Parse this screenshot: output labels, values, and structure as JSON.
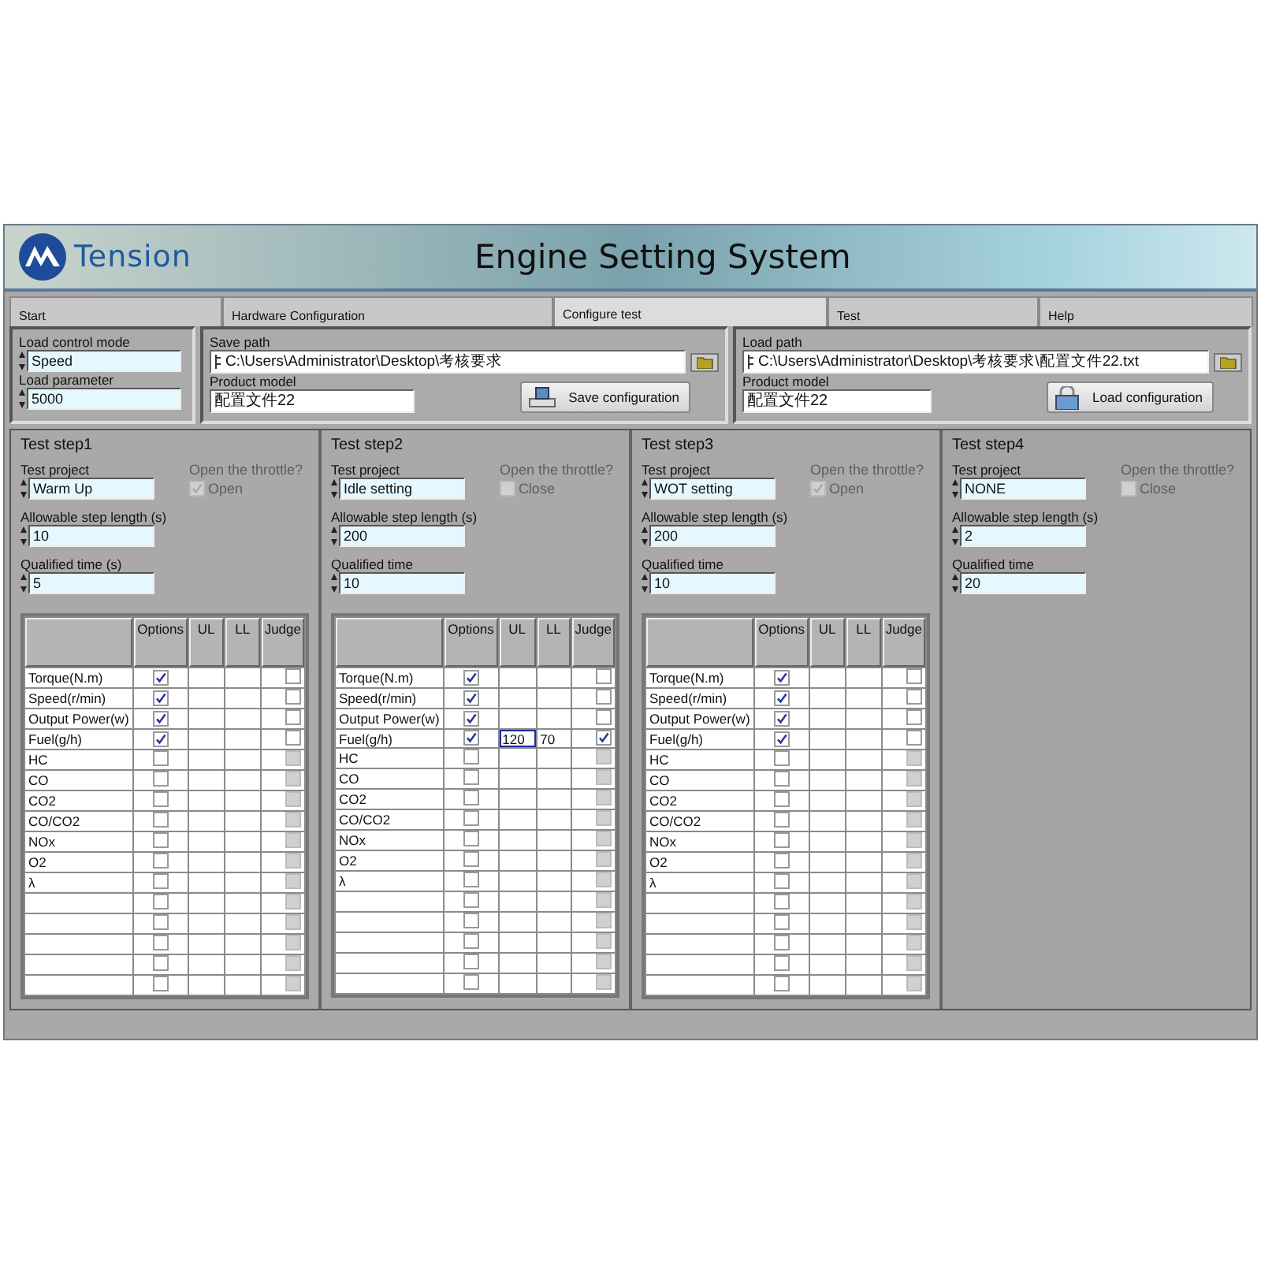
{
  "window": {
    "title": "Engine Setting System",
    "logo": "Tension"
  },
  "tabs": [
    {
      "label": "Start",
      "selected": false
    },
    {
      "label": "Hardware Configuration",
      "selected": false
    },
    {
      "label": "Configure test",
      "selected": true
    },
    {
      "label": "Test",
      "selected": false
    },
    {
      "label": "Help",
      "selected": false
    }
  ],
  "load_control": {
    "mode_label": "Load control mode",
    "mode": "Speed",
    "param_label": "Load parameter",
    "param": "5000"
  },
  "save": {
    "path_label": "Save path",
    "path": "C:\\Users\\Administrator\\Desktop\\考核要求",
    "model_label": "Product model",
    "model": "配置文件22",
    "button": "Save configuration"
  },
  "load": {
    "path_label": "Load path",
    "path": "C:\\Users\\Administrator\\Desktop\\考核要求\\配置文件22.txt",
    "model_label": "Product model",
    "model": "配置文件22",
    "button": "Load configuration"
  },
  "steps": [
    {
      "title": "Test step1",
      "project_label": "Test project",
      "project": "Warm Up",
      "throttle_label": "Open the throttle?",
      "throttle": {
        "label": "Open",
        "checked": true
      },
      "length_label": "Allowable step length (s)",
      "length": "10",
      "time_label": "Qualified time (s)",
      "time": "5",
      "table": {
        "columns": [
          "Options",
          "UL",
          "LL",
          "Judge"
        ],
        "rows": [
          {
            "name": "Torque(N.m)",
            "option": true,
            "judge": false,
            "judge_disabled": false
          },
          {
            "name": "Speed(r/min)",
            "option": true,
            "judge": false,
            "judge_disabled": false
          },
          {
            "name": "Output Power(w)",
            "option": true,
            "judge": false,
            "judge_disabled": false
          },
          {
            "name": "Fuel(g/h)",
            "option": true,
            "judge": false,
            "judge_disabled": false
          },
          {
            "name": "HC",
            "option": false,
            "judge": false,
            "judge_disabled": true
          },
          {
            "name": "CO",
            "option": false,
            "judge": false,
            "judge_disabled": true
          },
          {
            "name": "CO2",
            "option": false,
            "judge": false,
            "judge_disabled": true
          },
          {
            "name": "CO/CO2",
            "option": false,
            "judge": false,
            "judge_disabled": true
          },
          {
            "name": "NOx",
            "option": false,
            "judge": false,
            "judge_disabled": true
          },
          {
            "name": "O2",
            "option": false,
            "judge": false,
            "judge_disabled": true
          },
          {
            "name": "λ",
            "option": false,
            "judge": false,
            "judge_disabled": true
          },
          {
            "option": false,
            "judge": false,
            "judge_disabled": true
          },
          {
            "option": false,
            "judge": false,
            "judge_disabled": true
          },
          {
            "option": false,
            "judge": false,
            "judge_disabled": true
          },
          {
            "option": false,
            "judge": false,
            "judge_disabled": true
          },
          {
            "option": false,
            "judge": false,
            "judge_disabled": true
          }
        ]
      }
    },
    {
      "title": "Test step2",
      "project_label": "Test project",
      "project": "Idle setting",
      "throttle_label": "Open the throttle?",
      "throttle": {
        "label": "Close",
        "checked": false
      },
      "length_label": "Allowable step length (s)",
      "length": "200",
      "time_label": "Qualified time",
      "time": "10",
      "table": {
        "columns": [
          "Options",
          "UL",
          "LL",
          "Judge"
        ],
        "rows": [
          {
            "name": "Torque(N.m)",
            "option": true,
            "judge": false,
            "judge_disabled": false
          },
          {
            "name": "Speed(r/min)",
            "option": true,
            "judge": false,
            "judge_disabled": false
          },
          {
            "name": "Output Power(w)",
            "option": true,
            "judge": false,
            "judge_disabled": false
          },
          {
            "name": "Fuel(g/h)",
            "option": true,
            "ul": "120",
            "ll": "70",
            "ul_focused": true,
            "judge": true,
            "judge_disabled": false
          },
          {
            "name": "HC",
            "option": false,
            "judge": false,
            "judge_disabled": true
          },
          {
            "name": "CO",
            "option": false,
            "judge": false,
            "judge_disabled": true
          },
          {
            "name": "CO2",
            "option": false,
            "judge": false,
            "judge_disabled": true
          },
          {
            "name": "CO/CO2",
            "option": false,
            "judge": false,
            "judge_disabled": true
          },
          {
            "name": "NOx",
            "option": false,
            "judge": false,
            "judge_disabled": true
          },
          {
            "name": "O2",
            "option": false,
            "judge": false,
            "judge_disabled": true
          },
          {
            "name": "λ",
            "option": false,
            "judge": false,
            "judge_disabled": true
          },
          {
            "option": false,
            "judge": false,
            "judge_disabled": true
          },
          {
            "option": false,
            "judge": false,
            "judge_disabled": true
          },
          {
            "option": false,
            "judge": false,
            "judge_disabled": true
          },
          {
            "option": false,
            "judge": false,
            "judge_disabled": true
          },
          {
            "option": false,
            "judge": false,
            "judge_disabled": true
          }
        ]
      }
    },
    {
      "title": "Test step3",
      "project_label": "Test project",
      "project": "WOT setting",
      "throttle_label": "Open the throttle?",
      "throttle": {
        "label": "Open",
        "checked": true
      },
      "length_label": "Allowable step length (s)",
      "length": "200",
      "time_label": "Qualified time",
      "time": "10",
      "table": {
        "columns": [
          "Options",
          "UL",
          "LL",
          "Judge"
        ],
        "rows": [
          {
            "name": "Torque(N.m)",
            "option": true,
            "judge": false,
            "judge_disabled": false
          },
          {
            "name": "Speed(r/min)",
            "option": true,
            "judge": false,
            "judge_disabled": false
          },
          {
            "name": "Output Power(w)",
            "option": true,
            "judge": false,
            "judge_disabled": false
          },
          {
            "name": "Fuel(g/h)",
            "option": true,
            "judge": false,
            "judge_disabled": false
          },
          {
            "name": "HC",
            "option": false,
            "judge": false,
            "judge_disabled": true
          },
          {
            "name": "CO",
            "option": false,
            "judge": false,
            "judge_disabled": true
          },
          {
            "name": "CO2",
            "option": false,
            "judge": false,
            "judge_disabled": true
          },
          {
            "name": "CO/CO2",
            "option": false,
            "judge": false,
            "judge_disabled": true
          },
          {
            "name": "NOx",
            "option": false,
            "judge": false,
            "judge_disabled": true
          },
          {
            "name": "O2",
            "option": false,
            "judge": false,
            "judge_disabled": true
          },
          {
            "name": "λ",
            "option": false,
            "judge": false,
            "judge_disabled": true
          },
          {
            "option": false,
            "judge": false,
            "judge_disabled": true
          },
          {
            "option": false,
            "judge": false,
            "judge_disabled": true
          },
          {
            "option": false,
            "judge": false,
            "judge_disabled": true
          },
          {
            "option": false,
            "judge": false,
            "judge_disabled": true
          },
          {
            "option": false,
            "judge": false,
            "judge_disabled": true
          }
        ]
      }
    },
    {
      "title": "Test step4",
      "project_label": "Test project",
      "project": "NONE",
      "throttle_label": "Open the throttle?",
      "throttle": {
        "label": "Close",
        "checked": false
      },
      "length_label": "Allowable step length (s)",
      "length": "2",
      "time_label": "Qualified time",
      "time": "20"
    }
  ]
}
